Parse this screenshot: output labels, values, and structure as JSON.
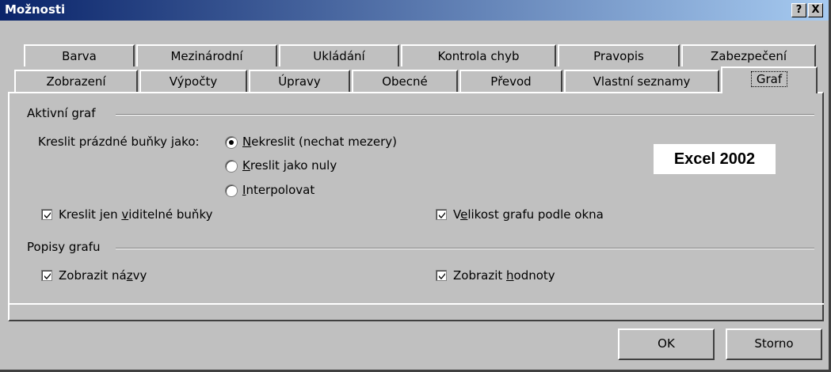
{
  "window": {
    "title": "Možnosti",
    "help_label": "?",
    "close_label": "X"
  },
  "tabs_row1": [
    "Barva",
    "Mezinárodní",
    "Ukládání",
    "Kontrola chyb",
    "Pravopis",
    "Zabezpečení"
  ],
  "tabs_row2": [
    "Zobrazení",
    "Výpočty",
    "Úpravy",
    "Obecné",
    "Převod",
    "Vlastní seznamy",
    "Graf"
  ],
  "active_tab": "Graf",
  "active_chart": {
    "group_label": "Aktivní graf",
    "empty_cells_label": "Kreslit prázdné buňky jako:",
    "options": [
      {
        "label_pre": "",
        "accel": "N",
        "label_post": "ekreslit (nechat mezery)",
        "checked": true
      },
      {
        "label_pre": "",
        "accel": "K",
        "label_post": "reslit jako nuly",
        "checked": false
      },
      {
        "label_pre": "",
        "accel": "I",
        "label_post": "nterpolovat",
        "checked": false
      }
    ],
    "visible_only": {
      "label_pre": "Kreslit jen ",
      "accel": "v",
      "label_post": "iditelné buňky",
      "checked": true
    },
    "size_with_window": {
      "label_pre": "V",
      "accel": "e",
      "label_post": "likost grafu podle okna",
      "checked": true
    }
  },
  "chart_tips": {
    "group_label": "Popisy grafu",
    "show_names": {
      "label_pre": "Zobrazit ná",
      "accel": "z",
      "label_post": "vy",
      "checked": true
    },
    "show_values": {
      "label_pre": "Zobrazit ",
      "accel": "h",
      "label_post": "odnoty",
      "checked": true
    }
  },
  "watermark": "Excel 2002",
  "buttons": {
    "ok": "OK",
    "cancel": "Storno"
  },
  "colors": {
    "face": "#c0c0c0",
    "title_start": "#0a246a",
    "title_end": "#a6caf0"
  }
}
